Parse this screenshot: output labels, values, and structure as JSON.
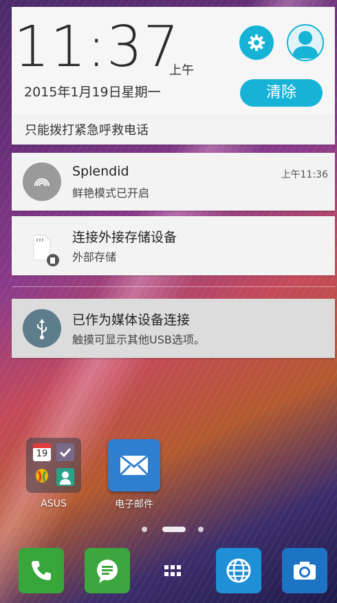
{
  "lockscreen": {
    "time": "11:37",
    "ampm": "上午",
    "date": "2015年1月19日星期一",
    "clear_label": "清除",
    "emergency_text": "只能拨打紧急呼救电话"
  },
  "notifications": [
    {
      "title": "Splendid",
      "subtitle": "鲜艳模式已开启",
      "time": "上午11:36",
      "icon": "splendid-rainbow-icon"
    },
    {
      "title": "连接外接存储设备",
      "subtitle": "外部存储",
      "time": "",
      "icon": "sd-card-icon"
    },
    {
      "title": "已作为媒体设备连接",
      "subtitle": "触摸可显示其他USB选项。",
      "time": "",
      "icon": "usb-icon"
    }
  ],
  "home": {
    "apps": [
      {
        "label": "ASUS",
        "icon": "folder-icon"
      },
      {
        "label": "电子邮件",
        "icon": "email-icon"
      }
    ],
    "folder_calendar_day": "19",
    "dock": [
      "phone-icon",
      "messages-icon",
      "app-drawer-icon",
      "browser-icon",
      "camera-icon"
    ]
  },
  "colors": {
    "accent": "#16b3d6",
    "card_bg": "#f3f3f3",
    "usb_highlight": "#dcdcdc"
  }
}
